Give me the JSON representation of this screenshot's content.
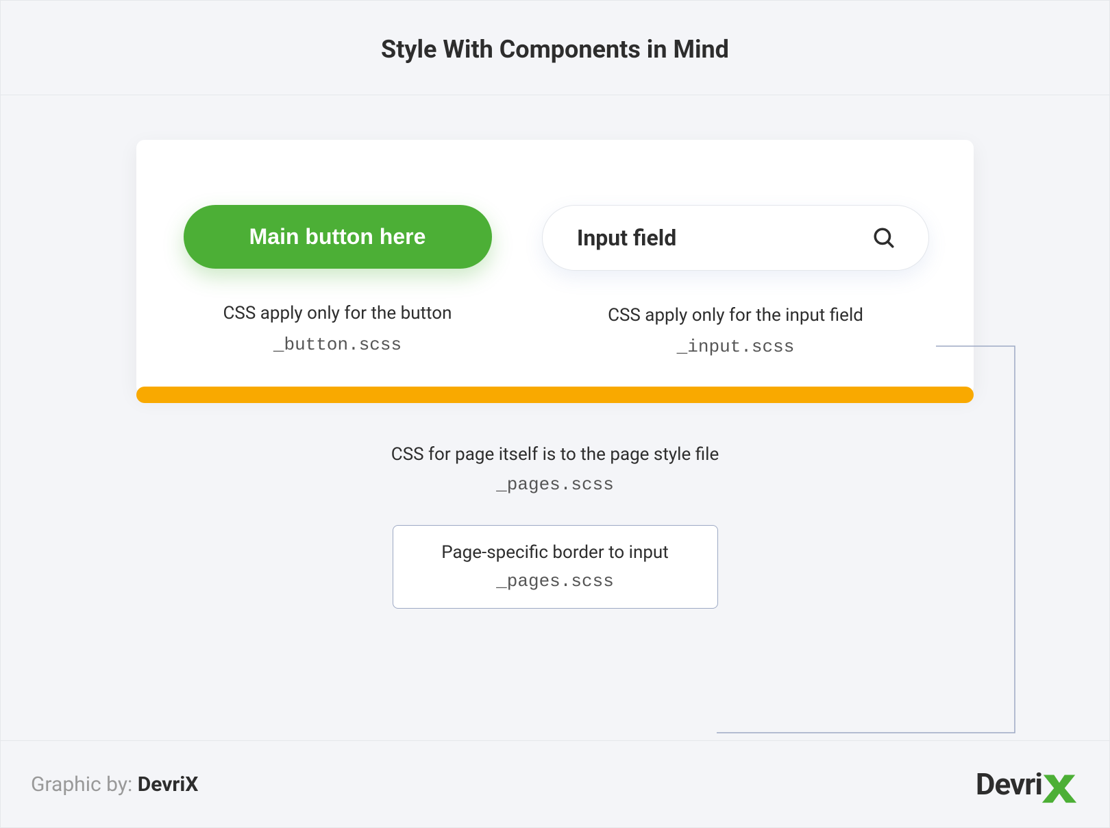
{
  "header": {
    "title": "Style With Components in Mind"
  },
  "card": {
    "button": {
      "label": "Main button here",
      "caption": "CSS apply only for the button",
      "file": "_button.scss"
    },
    "input": {
      "placeholder": "Input field",
      "caption": "CSS apply only for the input field",
      "file": "_input.scss"
    }
  },
  "page": {
    "caption": "CSS for page itself is to the page style file",
    "file": "_pages.scss"
  },
  "border_box": {
    "title": "Page-specific border to input",
    "file": "_pages.scss"
  },
  "footer": {
    "prefix": "Graphic by: ",
    "brand": "DevriX"
  },
  "colors": {
    "green": "#4caf36",
    "orange": "#f9a900",
    "border": "#9da9c4"
  }
}
